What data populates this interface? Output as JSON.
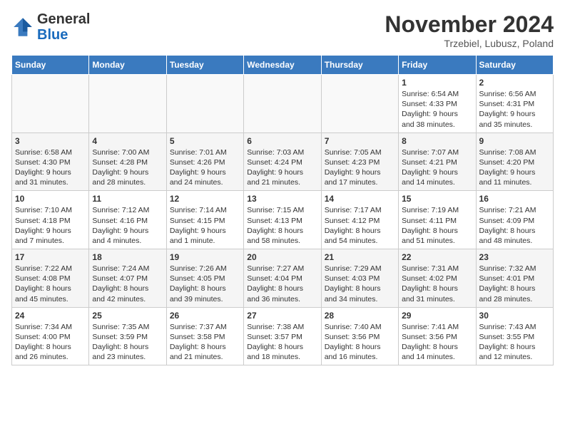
{
  "logo": {
    "general": "General",
    "blue": "Blue"
  },
  "title": "November 2024",
  "location": "Trzebiel, Lubusz, Poland",
  "days_header": [
    "Sunday",
    "Monday",
    "Tuesday",
    "Wednesday",
    "Thursday",
    "Friday",
    "Saturday"
  ],
  "weeks": [
    [
      {
        "num": "",
        "info": ""
      },
      {
        "num": "",
        "info": ""
      },
      {
        "num": "",
        "info": ""
      },
      {
        "num": "",
        "info": ""
      },
      {
        "num": "",
        "info": ""
      },
      {
        "num": "1",
        "info": "Sunrise: 6:54 AM\nSunset: 4:33 PM\nDaylight: 9 hours\nand 38 minutes."
      },
      {
        "num": "2",
        "info": "Sunrise: 6:56 AM\nSunset: 4:31 PM\nDaylight: 9 hours\nand 35 minutes."
      }
    ],
    [
      {
        "num": "3",
        "info": "Sunrise: 6:58 AM\nSunset: 4:30 PM\nDaylight: 9 hours\nand 31 minutes."
      },
      {
        "num": "4",
        "info": "Sunrise: 7:00 AM\nSunset: 4:28 PM\nDaylight: 9 hours\nand 28 minutes."
      },
      {
        "num": "5",
        "info": "Sunrise: 7:01 AM\nSunset: 4:26 PM\nDaylight: 9 hours\nand 24 minutes."
      },
      {
        "num": "6",
        "info": "Sunrise: 7:03 AM\nSunset: 4:24 PM\nDaylight: 9 hours\nand 21 minutes."
      },
      {
        "num": "7",
        "info": "Sunrise: 7:05 AM\nSunset: 4:23 PM\nDaylight: 9 hours\nand 17 minutes."
      },
      {
        "num": "8",
        "info": "Sunrise: 7:07 AM\nSunset: 4:21 PM\nDaylight: 9 hours\nand 14 minutes."
      },
      {
        "num": "9",
        "info": "Sunrise: 7:08 AM\nSunset: 4:20 PM\nDaylight: 9 hours\nand 11 minutes."
      }
    ],
    [
      {
        "num": "10",
        "info": "Sunrise: 7:10 AM\nSunset: 4:18 PM\nDaylight: 9 hours\nand 7 minutes."
      },
      {
        "num": "11",
        "info": "Sunrise: 7:12 AM\nSunset: 4:16 PM\nDaylight: 9 hours\nand 4 minutes."
      },
      {
        "num": "12",
        "info": "Sunrise: 7:14 AM\nSunset: 4:15 PM\nDaylight: 9 hours\nand 1 minute."
      },
      {
        "num": "13",
        "info": "Sunrise: 7:15 AM\nSunset: 4:13 PM\nDaylight: 8 hours\nand 58 minutes."
      },
      {
        "num": "14",
        "info": "Sunrise: 7:17 AM\nSunset: 4:12 PM\nDaylight: 8 hours\nand 54 minutes."
      },
      {
        "num": "15",
        "info": "Sunrise: 7:19 AM\nSunset: 4:11 PM\nDaylight: 8 hours\nand 51 minutes."
      },
      {
        "num": "16",
        "info": "Sunrise: 7:21 AM\nSunset: 4:09 PM\nDaylight: 8 hours\nand 48 minutes."
      }
    ],
    [
      {
        "num": "17",
        "info": "Sunrise: 7:22 AM\nSunset: 4:08 PM\nDaylight: 8 hours\nand 45 minutes."
      },
      {
        "num": "18",
        "info": "Sunrise: 7:24 AM\nSunset: 4:07 PM\nDaylight: 8 hours\nand 42 minutes."
      },
      {
        "num": "19",
        "info": "Sunrise: 7:26 AM\nSunset: 4:05 PM\nDaylight: 8 hours\nand 39 minutes."
      },
      {
        "num": "20",
        "info": "Sunrise: 7:27 AM\nSunset: 4:04 PM\nDaylight: 8 hours\nand 36 minutes."
      },
      {
        "num": "21",
        "info": "Sunrise: 7:29 AM\nSunset: 4:03 PM\nDaylight: 8 hours\nand 34 minutes."
      },
      {
        "num": "22",
        "info": "Sunrise: 7:31 AM\nSunset: 4:02 PM\nDaylight: 8 hours\nand 31 minutes."
      },
      {
        "num": "23",
        "info": "Sunrise: 7:32 AM\nSunset: 4:01 PM\nDaylight: 8 hours\nand 28 minutes."
      }
    ],
    [
      {
        "num": "24",
        "info": "Sunrise: 7:34 AM\nSunset: 4:00 PM\nDaylight: 8 hours\nand 26 minutes."
      },
      {
        "num": "25",
        "info": "Sunrise: 7:35 AM\nSunset: 3:59 PM\nDaylight: 8 hours\nand 23 minutes."
      },
      {
        "num": "26",
        "info": "Sunrise: 7:37 AM\nSunset: 3:58 PM\nDaylight: 8 hours\nand 21 minutes."
      },
      {
        "num": "27",
        "info": "Sunrise: 7:38 AM\nSunset: 3:57 PM\nDaylight: 8 hours\nand 18 minutes."
      },
      {
        "num": "28",
        "info": "Sunrise: 7:40 AM\nSunset: 3:56 PM\nDaylight: 8 hours\nand 16 minutes."
      },
      {
        "num": "29",
        "info": "Sunrise: 7:41 AM\nSunset: 3:56 PM\nDaylight: 8 hours\nand 14 minutes."
      },
      {
        "num": "30",
        "info": "Sunrise: 7:43 AM\nSunset: 3:55 PM\nDaylight: 8 hours\nand 12 minutes."
      }
    ]
  ]
}
